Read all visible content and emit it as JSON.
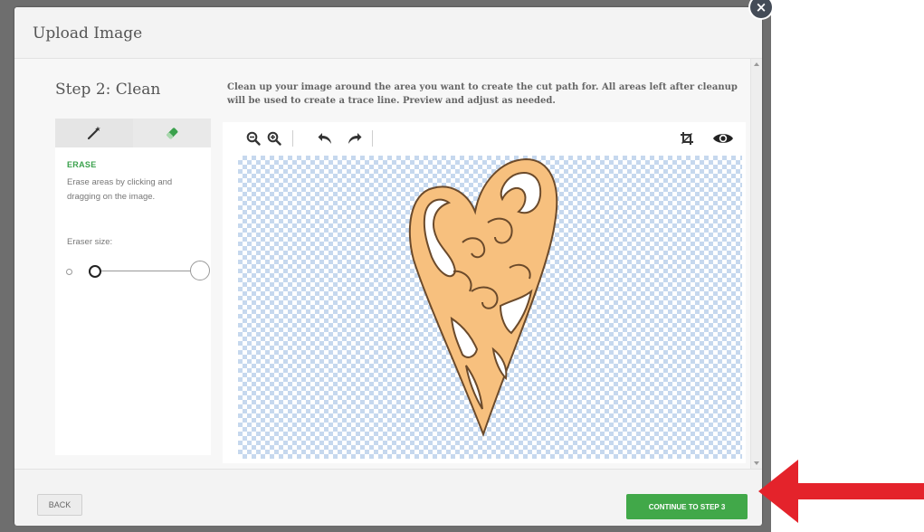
{
  "modal": {
    "title": "Upload Image",
    "close_glyph": "×"
  },
  "step": {
    "title": "Step 2: Clean",
    "instructions": "Clean up your image around the area you want to create the cut path for. All areas left after cleanup will be used to create a trace line. Preview and adjust as needed."
  },
  "tools": {
    "tabs": [
      {
        "icon": "magic-wand-icon"
      },
      {
        "icon": "eraser-icon",
        "active": true
      }
    ],
    "erase": {
      "title": "ERASE",
      "description": "Erase areas by clicking and dragging on the image.",
      "size_label": "Eraser size:",
      "size_level": 0.1
    }
  },
  "toolbar": {
    "left_icons": [
      "zoom-out-icon",
      "zoom-in-icon",
      "undo-icon",
      "redo-icon"
    ],
    "right_icons": [
      "crop-icon",
      "preview-eye-icon"
    ]
  },
  "footer": {
    "back_label": "BACK",
    "continue_label": "CONTINUE TO STEP 3"
  },
  "colors": {
    "accent_green": "#41a849",
    "erase_green": "#3aa14c",
    "heart_fill": "#f7c07e",
    "checker_blue": "#c6d8ee",
    "annotation_arrow": "#e4232b"
  }
}
